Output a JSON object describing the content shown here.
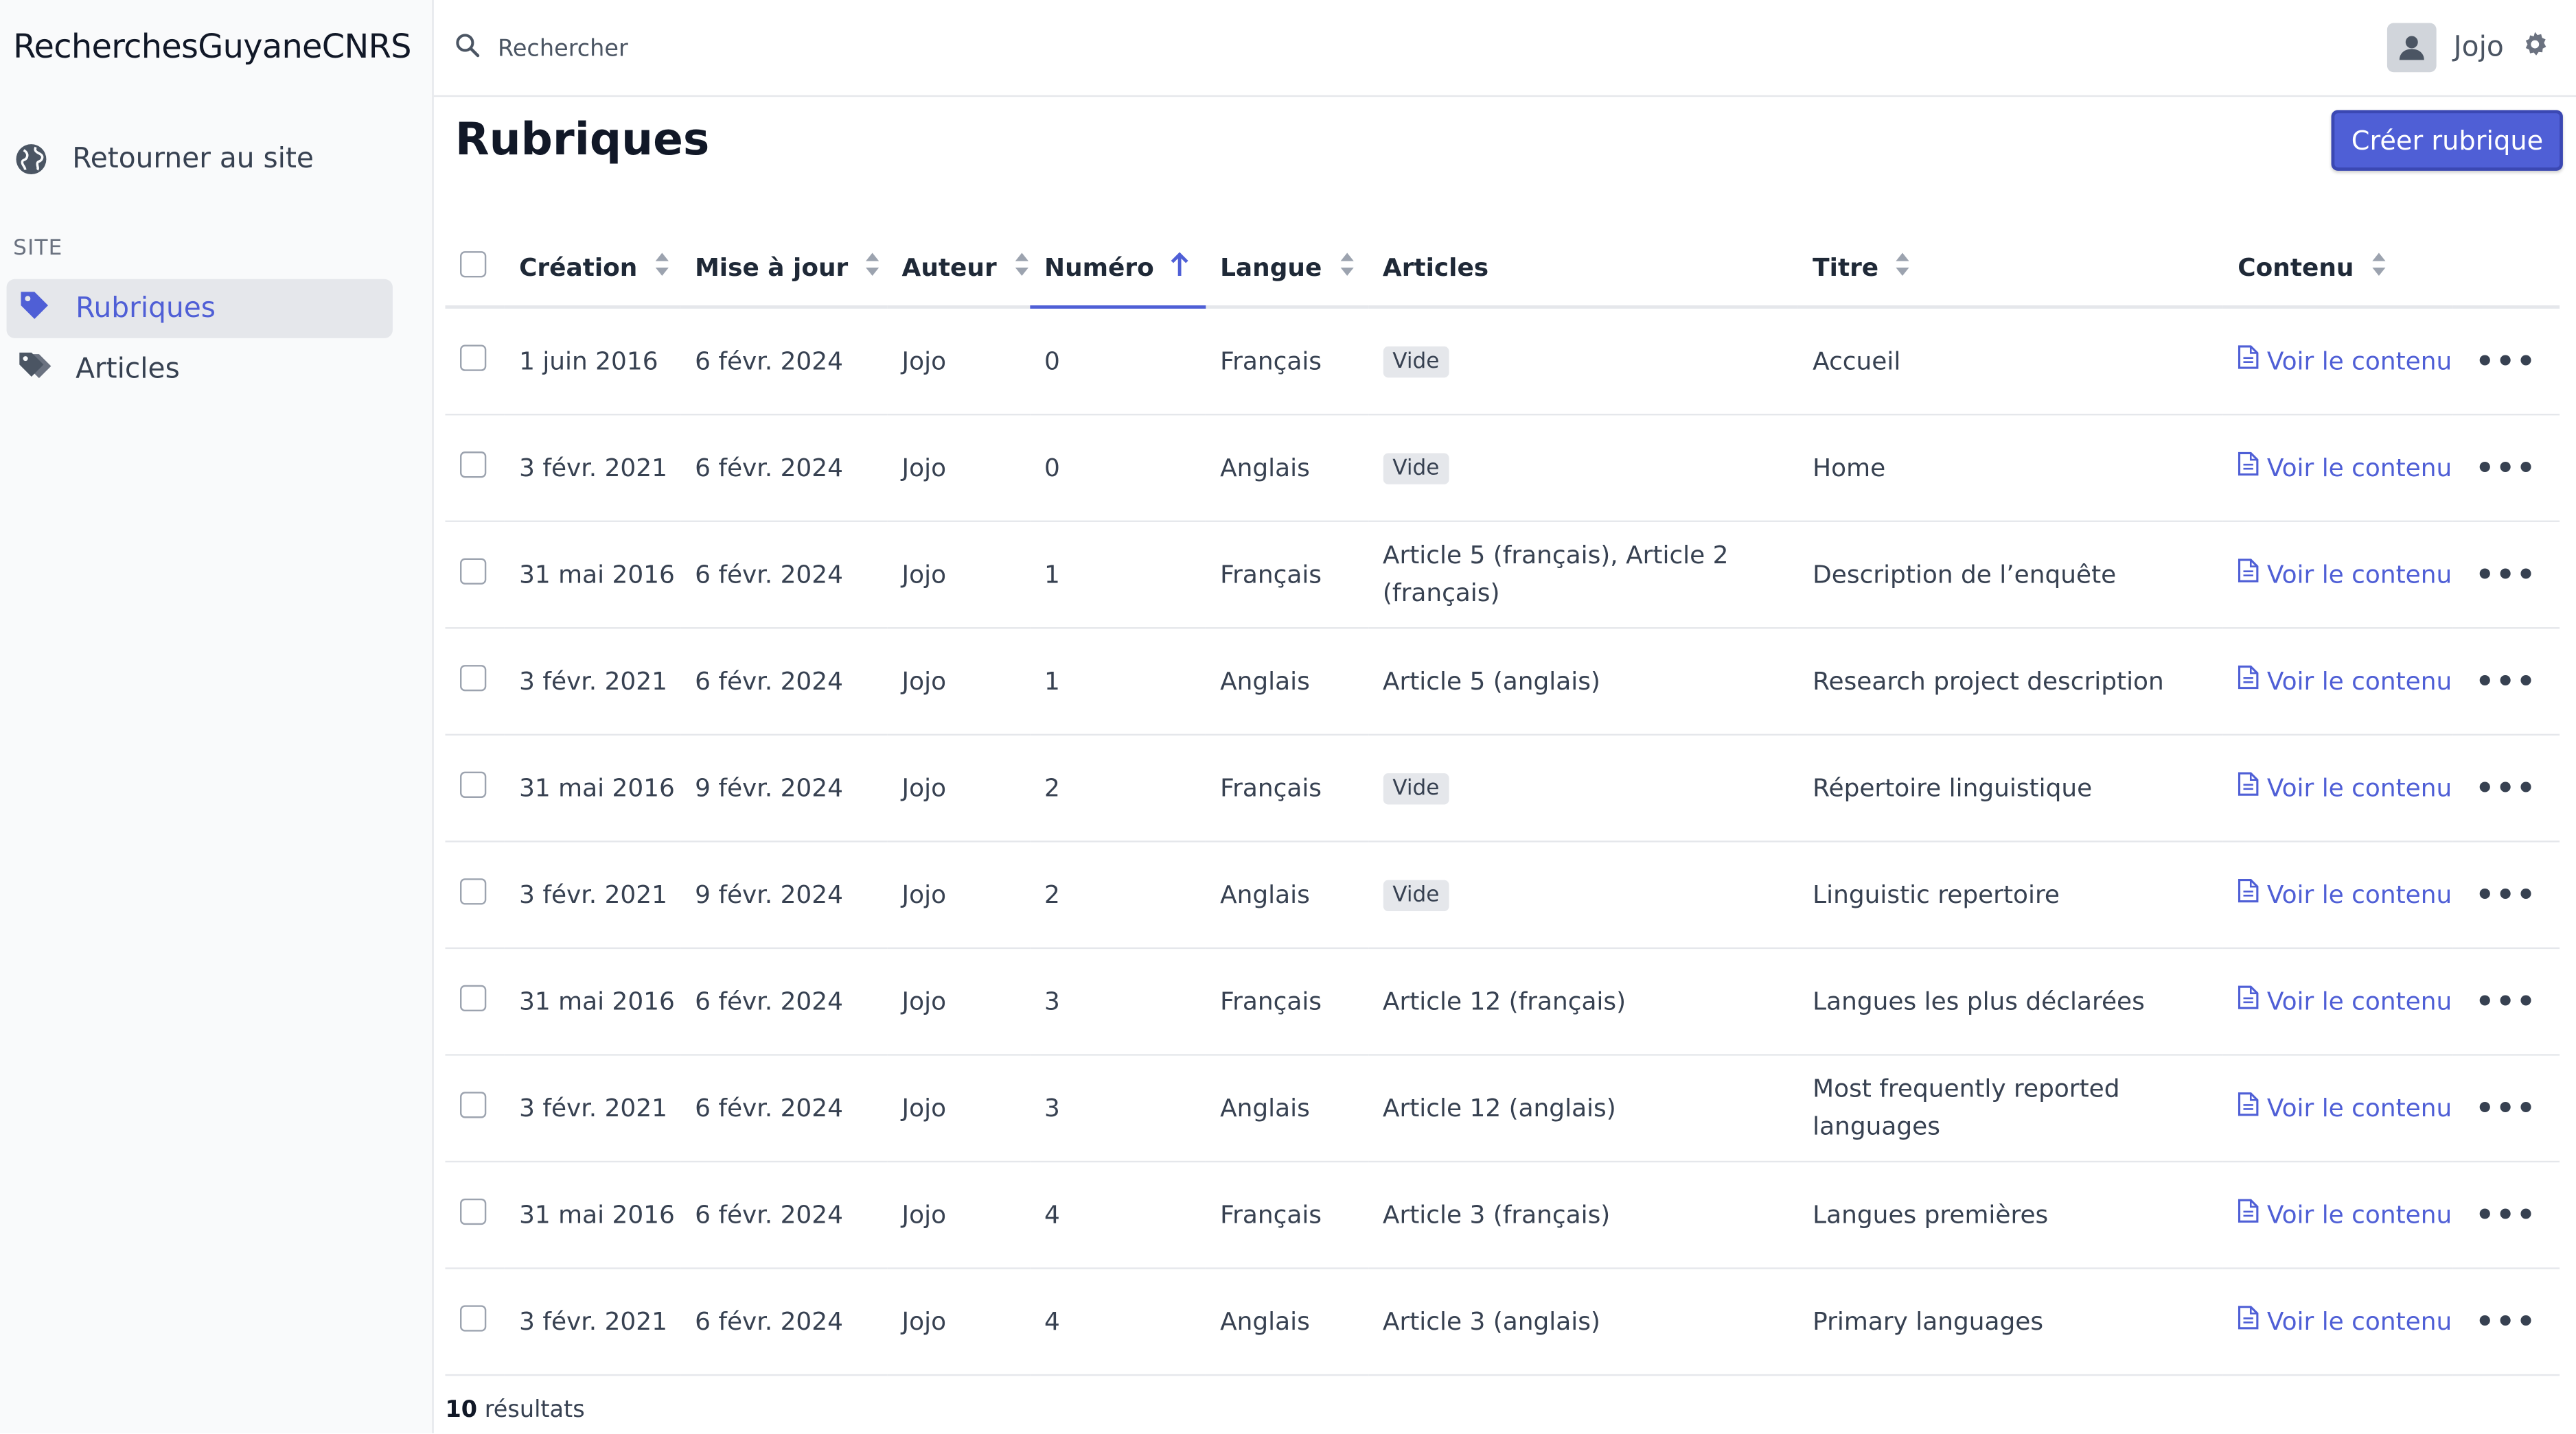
{
  "sidebar": {
    "brand": "RecherchesGuyaneCNRS",
    "back_link": "Retourner au site",
    "section": "SITE",
    "items": [
      {
        "label": "Rubriques",
        "active": true
      },
      {
        "label": "Articles",
        "active": false
      }
    ]
  },
  "topbar": {
    "search_placeholder": "Rechercher",
    "user_name": "Jojo"
  },
  "main": {
    "title": "Rubriques",
    "create_button": "Créer rubrique",
    "columns": [
      "Création",
      "Mise à jour",
      "Auteur",
      "Numéro",
      "Langue",
      "Articles",
      "Titre",
      "Contenu"
    ],
    "rows": [
      {
        "creation": "1 juin 2016",
        "maj": "6 févr. 2024",
        "auteur": "Jojo",
        "numero": "0",
        "langue": "Français",
        "articles": "Vide",
        "titre": "Accueil"
      },
      {
        "creation": "3 févr. 2021",
        "maj": "6 févr. 2024",
        "auteur": "Jojo",
        "numero": "0",
        "langue": "Anglais",
        "articles": "Vide",
        "titre": "Home"
      },
      {
        "creation": "31 mai 2016",
        "maj": "6 févr. 2024",
        "auteur": "Jojo",
        "numero": "1",
        "langue": "Français",
        "articles": "Article 5 (français), Article 2 (français)",
        "titre": "Description de l’enquête"
      },
      {
        "creation": "3 févr. 2021",
        "maj": "6 févr. 2024",
        "auteur": "Jojo",
        "numero": "1",
        "langue": "Anglais",
        "articles": "Article 5 (anglais)",
        "titre": "Research project description"
      },
      {
        "creation": "31 mai 2016",
        "maj": "9 févr. 2024",
        "auteur": "Jojo",
        "numero": "2",
        "langue": "Français",
        "articles": "Vide",
        "titre": "Répertoire linguistique"
      },
      {
        "creation": "3 févr. 2021",
        "maj": "9 févr. 2024",
        "auteur": "Jojo",
        "numero": "2",
        "langue": "Anglais",
        "articles": "Vide",
        "titre": "Linguistic repertoire"
      },
      {
        "creation": "31 mai 2016",
        "maj": "6 févr. 2024",
        "auteur": "Jojo",
        "numero": "3",
        "langue": "Français",
        "articles": "Article 12 (français)",
        "titre": "Langues les plus déclarées"
      },
      {
        "creation": "3 févr. 2021",
        "maj": "6 févr. 2024",
        "auteur": "Jojo",
        "numero": "3",
        "langue": "Anglais",
        "articles": "Article 12 (anglais)",
        "titre": "Most frequently reported languages"
      },
      {
        "creation": "31 mai 2016",
        "maj": "6 févr. 2024",
        "auteur": "Jojo",
        "numero": "4",
        "langue": "Français",
        "articles": "Article 3 (français)",
        "titre": "Langues premières"
      },
      {
        "creation": "3 févr. 2021",
        "maj": "6 févr. 2024",
        "auteur": "Jojo",
        "numero": "4",
        "langue": "Anglais",
        "articles": "Article 3 (anglais)",
        "titre": "Primary languages"
      }
    ],
    "content_link": "Voir le contenu",
    "empty_badge": "Vide",
    "row_menu": "•••",
    "results_count": "10",
    "results_label": "résultats"
  },
  "colors": {
    "accent": "#4f5fd6",
    "sidebar_bg": "#f9fafb",
    "active_bg": "#e5e7eb"
  }
}
